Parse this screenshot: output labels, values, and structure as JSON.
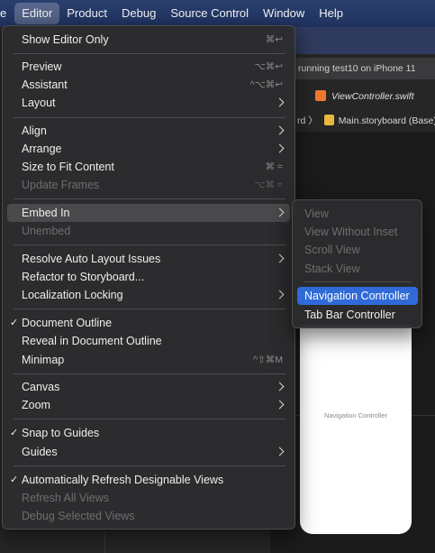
{
  "menubar": {
    "items": [
      "e",
      "Editor",
      "Product",
      "Debug",
      "Source Control",
      "Window",
      "Help"
    ]
  },
  "background": {
    "status_text": "running test10 on iPhone 11",
    "tab_file": "ViewController.swift",
    "breadcrumb_prev": "rd",
    "breadcrumb_sep": "〉",
    "breadcrumb_file": "Main.storyboard (Base)",
    "scene_label": "Navigation Controller"
  },
  "menu": {
    "items": [
      {
        "label": "Show Editor Only",
        "shortcut": "⌘↩"
      },
      {
        "label": "Preview",
        "shortcut": "⌥⌘↩"
      },
      {
        "label": "Assistant",
        "shortcut": "^⌥⌘↩"
      },
      {
        "label": "Layout"
      },
      {
        "label": "Align"
      },
      {
        "label": "Arrange"
      },
      {
        "label": "Size to Fit Content",
        "shortcut": "⌘ ="
      },
      {
        "label": "Update Frames",
        "shortcut": "⌥⌘ ="
      },
      {
        "label": "Embed In"
      },
      {
        "label": "Unembed"
      },
      {
        "label": "Resolve Auto Layout Issues"
      },
      {
        "label": "Refactor to Storyboard..."
      },
      {
        "label": "Localization Locking"
      },
      {
        "label": "Document Outline",
        "check": "✓"
      },
      {
        "label": "Reveal in Document Outline"
      },
      {
        "label": "Minimap",
        "shortcut": "^⇧⌘M"
      },
      {
        "label": "Canvas"
      },
      {
        "label": "Zoom"
      },
      {
        "label": "Snap to Guides",
        "check": "✓"
      },
      {
        "label": "Guides"
      },
      {
        "label": "Automatically Refresh Designable Views",
        "check": "✓"
      },
      {
        "label": "Refresh All Views"
      },
      {
        "label": "Debug Selected Views"
      }
    ]
  },
  "submenu": {
    "items": [
      {
        "label": "View"
      },
      {
        "label": "View Without Inset"
      },
      {
        "label": "Scroll View"
      },
      {
        "label": "Stack View"
      },
      {
        "label": "Navigation Controller"
      },
      {
        "label": "Tab Bar Controller"
      }
    ]
  },
  "colors": {
    "accent": "#2f6ad8",
    "menubar": "#2b3f6e",
    "menu_bg": "#2c2c2e"
  }
}
